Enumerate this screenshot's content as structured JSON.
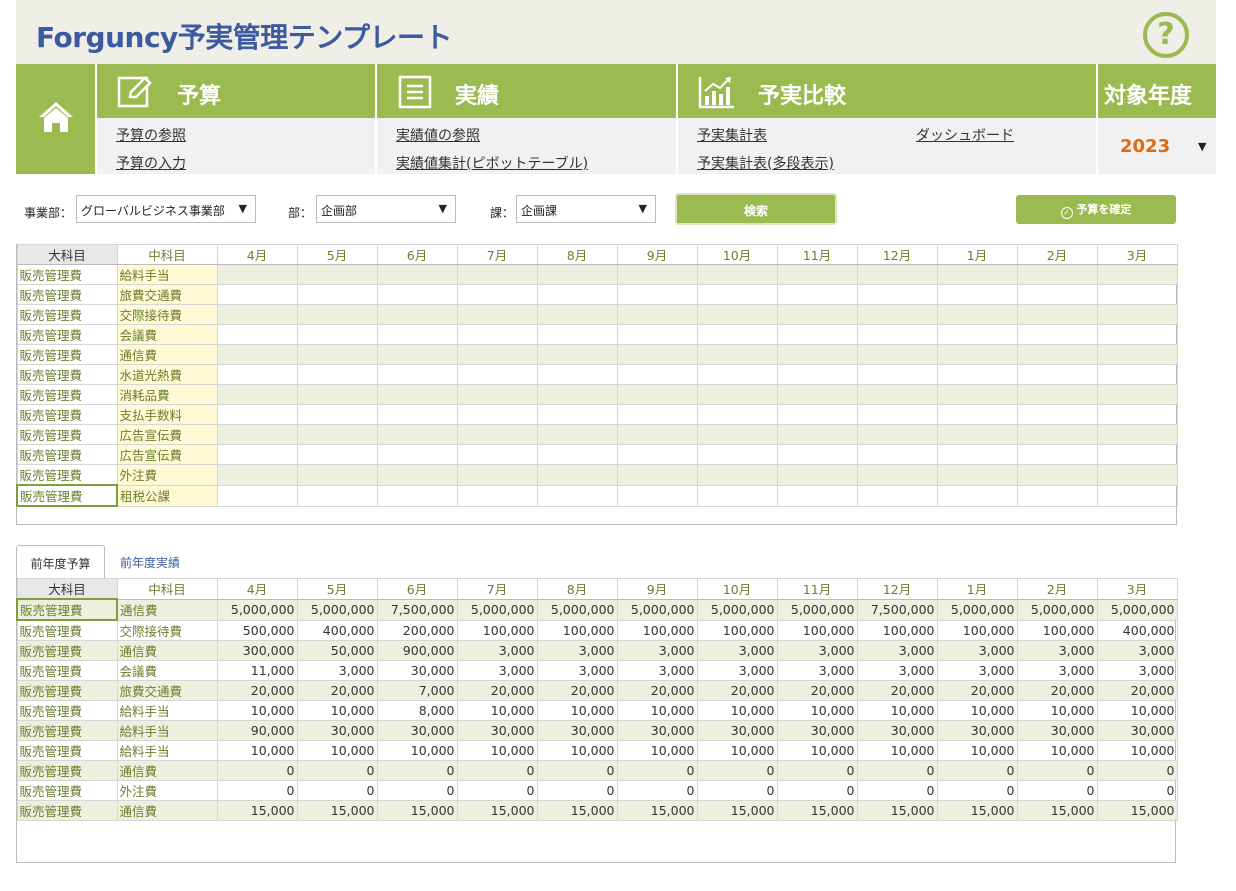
{
  "app": {
    "title": "Forguncy予実管理テンプレート",
    "help_glyph": "?"
  },
  "nav": {
    "budget": {
      "label": "予算",
      "links": [
        "予算の参照",
        "予算の入力"
      ]
    },
    "actual": {
      "label": "実績",
      "links": [
        "実績値の参照",
        "実績値集計(ピボットテーブル)"
      ]
    },
    "compare": {
      "label": "予実比較",
      "links": [
        "予実集計表",
        "ダッシュボード",
        "予実集計表(多段表示)"
      ]
    },
    "year": {
      "label": "対象年度",
      "value": "2023",
      "arrow": "▼"
    }
  },
  "filters": {
    "division": {
      "label": "事業部：",
      "value": "グローバルビジネス事業部"
    },
    "department": {
      "label": "部：",
      "value": "企画部"
    },
    "section": {
      "label": "課：",
      "value": "企画課"
    },
    "arrow": "▼",
    "search_label": "検索",
    "confirm_label": "予算を確定",
    "confirm_icon": "check-circle-icon"
  },
  "columns": [
    "大科目",
    "中科目",
    "4月",
    "5月",
    "6月",
    "7月",
    "8月",
    "9月",
    "10月",
    "11月",
    "12月",
    "1月",
    "2月",
    "3月"
  ],
  "input_table": {
    "rows": [
      [
        "販売管理費",
        "給料手当"
      ],
      [
        "販売管理費",
        "旅費交通費"
      ],
      [
        "販売管理費",
        "交際接待費"
      ],
      [
        "販売管理費",
        "会議費"
      ],
      [
        "販売管理費",
        "通信費"
      ],
      [
        "販売管理費",
        "水道光熱費"
      ],
      [
        "販売管理費",
        "消耗品費"
      ],
      [
        "販売管理費",
        "支払手数料"
      ],
      [
        "販売管理費",
        "広告宣伝費"
      ],
      [
        "販売管理費",
        "広告宣伝費"
      ],
      [
        "販売管理費",
        "外注費"
      ],
      [
        "販売管理費",
        "租税公課"
      ]
    ]
  },
  "tabs": [
    "前年度予算",
    "前年度実績"
  ],
  "prev_table": {
    "rows": [
      [
        "販売管理費",
        "通信費",
        "5,000,000",
        "5,000,000",
        "7,500,000",
        "5,000,000",
        "5,000,000",
        "5,000,000",
        "5,000,000",
        "5,000,000",
        "7,500,000",
        "5,000,000",
        "5,000,000",
        "5,000,000"
      ],
      [
        "販売管理費",
        "交際接待費",
        "500,000",
        "400,000",
        "200,000",
        "100,000",
        "100,000",
        "100,000",
        "100,000",
        "100,000",
        "100,000",
        "100,000",
        "100,000",
        "400,000"
      ],
      [
        "販売管理費",
        "通信費",
        "300,000",
        "50,000",
        "900,000",
        "3,000",
        "3,000",
        "3,000",
        "3,000",
        "3,000",
        "3,000",
        "3,000",
        "3,000",
        "3,000"
      ],
      [
        "販売管理費",
        "会議費",
        "11,000",
        "3,000",
        "30,000",
        "3,000",
        "3,000",
        "3,000",
        "3,000",
        "3,000",
        "3,000",
        "3,000",
        "3,000",
        "3,000"
      ],
      [
        "販売管理費",
        "旅費交通費",
        "20,000",
        "20,000",
        "7,000",
        "20,000",
        "20,000",
        "20,000",
        "20,000",
        "20,000",
        "20,000",
        "20,000",
        "20,000",
        "20,000"
      ],
      [
        "販売管理費",
        "給料手当",
        "10,000",
        "10,000",
        "8,000",
        "10,000",
        "10,000",
        "10,000",
        "10,000",
        "10,000",
        "10,000",
        "10,000",
        "10,000",
        "10,000"
      ],
      [
        "販売管理費",
        "給料手当",
        "90,000",
        "30,000",
        "30,000",
        "30,000",
        "30,000",
        "30,000",
        "30,000",
        "30,000",
        "30,000",
        "30,000",
        "30,000",
        "30,000"
      ],
      [
        "販売管理費",
        "給料手当",
        "10,000",
        "10,000",
        "10,000",
        "10,000",
        "10,000",
        "10,000",
        "10,000",
        "10,000",
        "10,000",
        "10,000",
        "10,000",
        "10,000"
      ],
      [
        "販売管理費",
        "通信費",
        "0",
        "0",
        "0",
        "0",
        "0",
        "0",
        "0",
        "0",
        "0",
        "0",
        "0",
        "0"
      ],
      [
        "販売管理費",
        "外注費",
        "0",
        "0",
        "0",
        "0",
        "0",
        "0",
        "0",
        "0",
        "0",
        "0",
        "0",
        "0"
      ],
      [
        "販売管理費",
        "通信費",
        "15,000",
        "15,000",
        "15,000",
        "15,000",
        "15,000",
        "15,000",
        "15,000",
        "15,000",
        "15,000",
        "15,000",
        "15,000",
        "15,000"
      ]
    ]
  }
}
